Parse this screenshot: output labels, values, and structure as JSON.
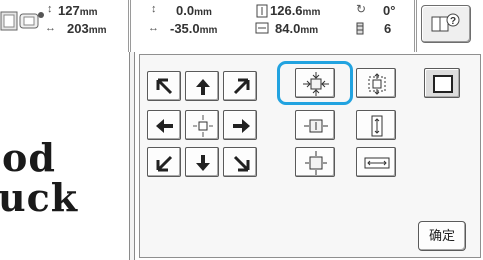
{
  "status": {
    "height_value": "127",
    "width_value": "203",
    "x_value": "0.0",
    "y_value": "-35.0",
    "size_h_value": "126.6",
    "size_w_value": "84.0",
    "angle_value": "0°",
    "thread_count": "6",
    "unit": "mm"
  },
  "preview": {
    "line1": "od",
    "line2": "uck"
  },
  "panel": {
    "ok_label": "确定"
  },
  "icons": {
    "frame": "embroidery-frame-icon",
    "help": "help-book-icon",
    "ok": "confirm-button"
  }
}
